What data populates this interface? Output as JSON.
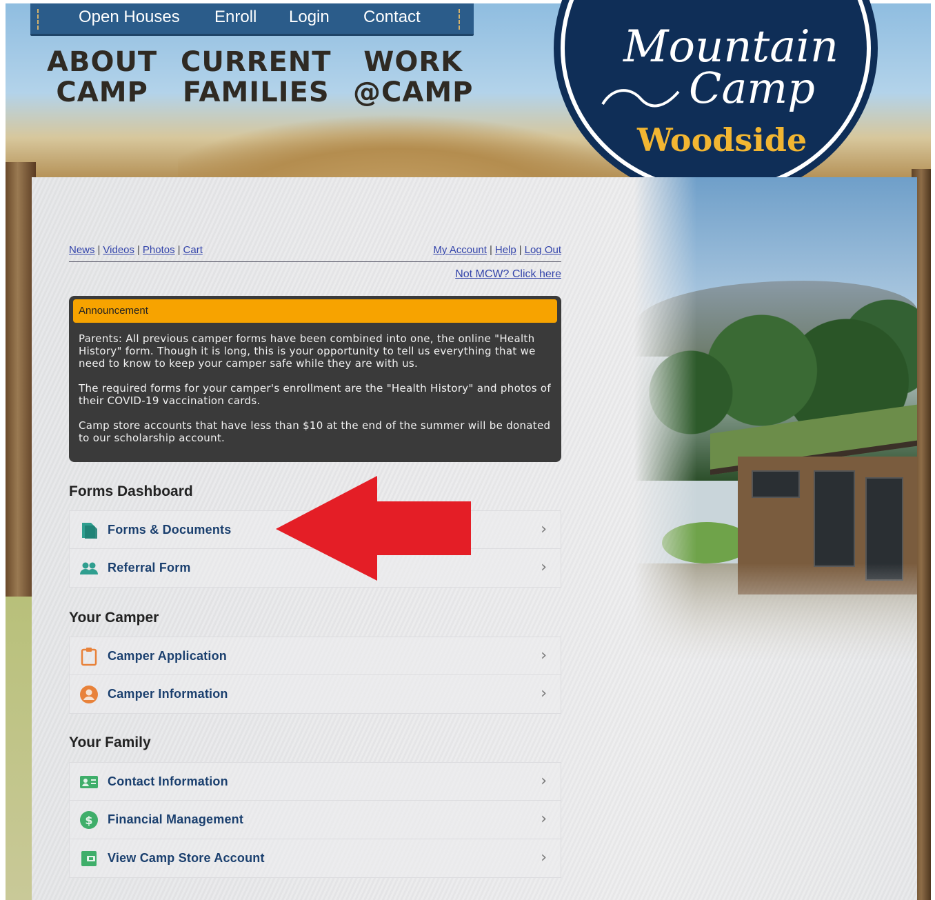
{
  "topnav": {
    "items": [
      "Open Houses",
      "Enroll",
      "Login",
      "Contact"
    ]
  },
  "bignav": [
    {
      "line1": "ABOUT",
      "line2": "CAMP"
    },
    {
      "line1": "CURRENT",
      "line2": "FAMILIES"
    },
    {
      "line1": "WORK",
      "line2": "@CAMP"
    }
  ],
  "logo": {
    "line1": "Mountain",
    "line2": "Camp",
    "line3": "Woodside"
  },
  "util": {
    "left": [
      "News",
      "Videos",
      "Photos",
      "Cart"
    ],
    "right": [
      "My Account",
      "Help",
      "Log Out"
    ],
    "not_mcw": "Not MCW? Click here"
  },
  "announcement": {
    "title": "Announcement",
    "p1": "Parents: All previous camper forms have been combined into one, the online \"Health History\" form. Though it is long, this is your opportunity to tell us everything that we need to know to keep your camper safe while they are with us.",
    "p2": "The required forms for your camper's enrollment are the \"Health History\" and photos of their COVID-19 vaccination cards.",
    "p3": "Camp store accounts that have less than $10 at the end of the summer will be donated to our scholarship account."
  },
  "sections": {
    "forms": {
      "title": "Forms Dashboard",
      "items": [
        {
          "label": "Forms & Documents",
          "icon": "document-icon",
          "color": "#2f9e8f"
        },
        {
          "label": "Referral Form",
          "icon": "people-icon",
          "color": "#2f9e8f"
        }
      ]
    },
    "camper": {
      "title": "Your Camper",
      "items": [
        {
          "label": "Camper Application",
          "icon": "clipboard-icon",
          "color": "#e8823a"
        },
        {
          "label": "Camper Information",
          "icon": "user-circle-icon",
          "color": "#e8823a"
        }
      ]
    },
    "family": {
      "title": "Your Family",
      "items": [
        {
          "label": "Contact Information",
          "icon": "contact-card-icon",
          "color": "#3fae6a"
        },
        {
          "label": "Financial Management",
          "icon": "dollar-icon",
          "color": "#3fae6a"
        },
        {
          "label": "View Camp Store Account",
          "icon": "wallet-icon",
          "color": "#3fae6a"
        }
      ]
    }
  },
  "chevron": "›",
  "colors": {
    "arrow": "#e41e26",
    "announcement_head": "#f7a300",
    "nav_blue": "#2b5c8a",
    "logo_navy": "#0f2e57",
    "logo_gold": "#f2b632"
  }
}
